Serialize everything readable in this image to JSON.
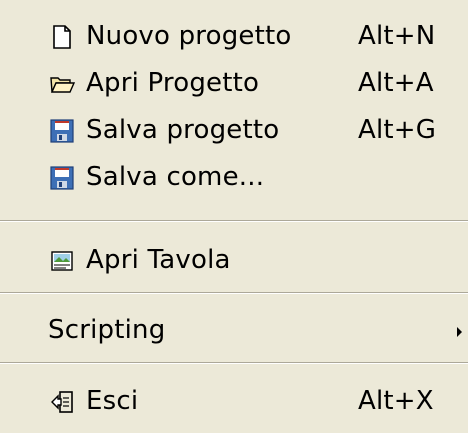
{
  "menu": {
    "items": [
      {
        "label": "Nuovo progetto",
        "shortcut": "Alt+N",
        "icon": "new-document-icon"
      },
      {
        "label": "Apri Progetto",
        "shortcut": "Alt+A",
        "icon": "open-folder-icon"
      },
      {
        "label": "Salva progetto",
        "shortcut": "Alt+G",
        "icon": "floppy-disk-icon"
      },
      {
        "label": "Salva come...",
        "shortcut": "",
        "icon": "floppy-disk-icon"
      },
      {
        "label": "Apri Tavola",
        "shortcut": "",
        "icon": "image-table-icon"
      },
      {
        "label": "Scripting",
        "shortcut": "",
        "icon": "",
        "submenu": true
      },
      {
        "label": "Esci",
        "shortcut": "Alt+X",
        "icon": "exit-icon"
      }
    ]
  },
  "colors": {
    "background": "#ece9d8",
    "separator_dark": "#aca899",
    "separator_light": "#ffffff",
    "floppy_blue": "#3d6fb6",
    "floppy_red": "#c0392b"
  }
}
